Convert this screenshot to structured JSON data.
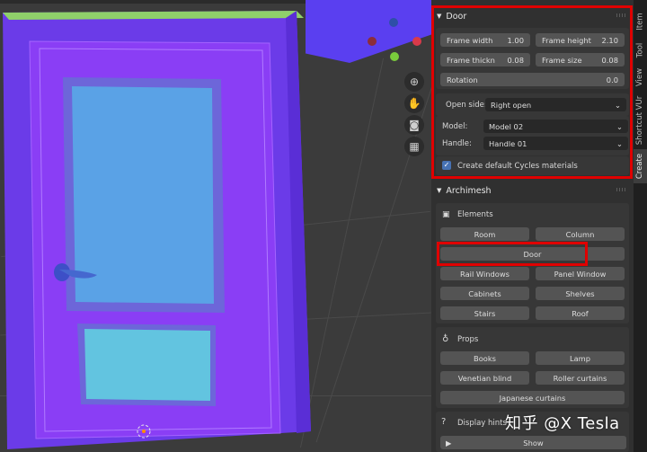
{
  "sidebar": {
    "tabs": [
      {
        "label": "Item"
      },
      {
        "label": "Tool"
      },
      {
        "label": "View"
      },
      {
        "label": "Shortcut VUr"
      },
      {
        "label": "Create"
      }
    ]
  },
  "door_panel": {
    "title": "Door",
    "frame_width": {
      "label": "Frame width",
      "value": "1.00"
    },
    "frame_height": {
      "label": "Frame height",
      "value": "2.10"
    },
    "frame_thick": {
      "label": "Frame thickn",
      "value": "0.08"
    },
    "frame_size": {
      "label": "Frame size",
      "value": "0.08"
    },
    "rotation": {
      "label": "Rotation",
      "value": "0.0"
    },
    "open_side": {
      "label": "Open side:",
      "value": "Right open"
    },
    "model": {
      "label": "Model:",
      "value": "Model 02"
    },
    "handle": {
      "label": "Handle:",
      "value": "Handle 01"
    },
    "cycles": {
      "label": "Create default Cycles materials",
      "checked": true
    }
  },
  "archimesh": {
    "title": "Archimesh",
    "elements": {
      "title": "Elements",
      "buttons": [
        "Room",
        "Column",
        "Door",
        "Rail Windows",
        "Panel Window",
        "Cabinets",
        "Shelves",
        "Stairs",
        "Roof"
      ]
    },
    "props": {
      "title": "Props",
      "buttons": [
        "Books",
        "Lamp",
        "Venetian blind",
        "Roller curtains",
        "Japanese curtains"
      ]
    },
    "display_hints": {
      "label": "Display hints",
      "button": "Show"
    }
  },
  "watermark": "知乎 @X Tesla",
  "colors": {
    "highlight": "#e00000",
    "accent": "#4772b3",
    "door": "#7b3ff2"
  }
}
